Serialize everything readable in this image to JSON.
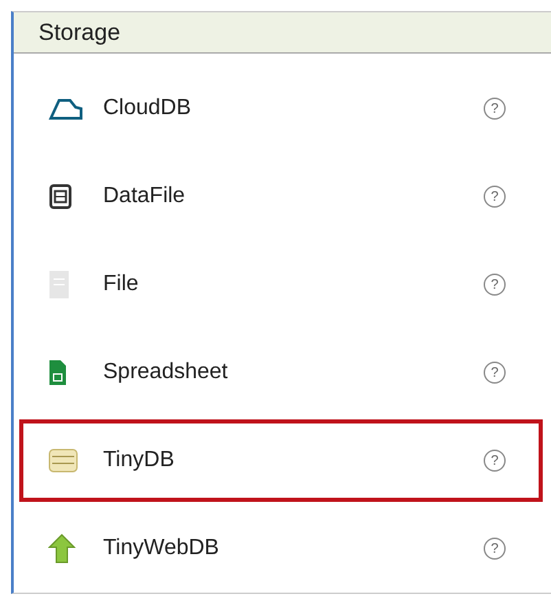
{
  "panel": {
    "title": "Storage"
  },
  "items": [
    {
      "label": "CloudDB",
      "kind": "cloud",
      "help": "?",
      "highlighted": false
    },
    {
      "label": "DataFile",
      "kind": "datafile",
      "help": "?",
      "highlighted": false
    },
    {
      "label": "File",
      "kind": "file",
      "help": "?",
      "highlighted": false
    },
    {
      "label": "Spreadsheet",
      "kind": "sheet",
      "help": "?",
      "highlighted": false
    },
    {
      "label": "TinyDB",
      "kind": "db",
      "help": "?",
      "highlighted": true
    },
    {
      "label": "TinyWebDB",
      "kind": "upload",
      "help": "?",
      "highlighted": false
    }
  ]
}
